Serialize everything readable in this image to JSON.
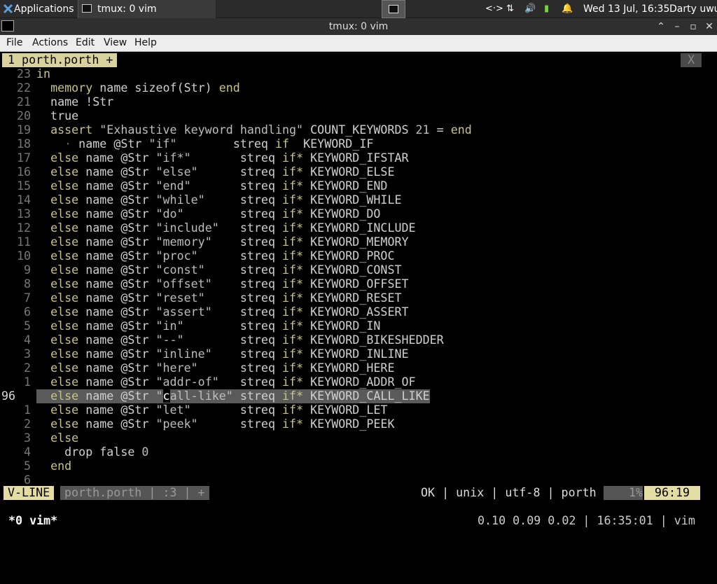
{
  "panel": {
    "applications_label": "Applications",
    "task_label": "tmux: 0 vim",
    "clock": "Wed 13 Jul, 16:35",
    "user": "Darty uwu",
    "tray_glyphs": [
      "<·>",
      "⇅",
      "🔊",
      "▮",
      "🔔"
    ]
  },
  "window": {
    "title": "tmux: 0 vim",
    "controls": [
      "⌃",
      "–",
      "▫",
      "✕"
    ]
  },
  "menubar": {
    "items": [
      "File",
      "Actions",
      "Edit",
      "View",
      "Help"
    ]
  },
  "vim": {
    "tab_label": "1 porth.porth +",
    "tab_close": "X",
    "mode": "V-LINE",
    "file_info": "porth.porth | :3 | +",
    "status_right": "OK | unix | utf-8 | porth",
    "percent": "1%",
    "position": "96:19"
  },
  "tmux": {
    "window": "*0 vim*",
    "status": "0.10 0.09 0.02 | 16:35:01 | vim"
  },
  "lines": [
    {
      "n": "23",
      "code": "in"
    },
    {
      "n": "22",
      "code": "  memory name sizeof(Str) end"
    },
    {
      "n": "21",
      "code": "  name !Str"
    },
    {
      "n": "20",
      "code": "  true"
    },
    {
      "n": "19",
      "code": "  assert \"Exhaustive keyword handling\" COUNT_KEYWORDS 21 = end"
    },
    {
      "n": "18",
      "code": "    · name @Str \"if\"        streq if  KEYWORD_IF"
    },
    {
      "n": "17",
      "code": "  else name @Str \"if*\"       streq if* KEYWORD_IFSTAR"
    },
    {
      "n": "16",
      "code": "  else name @Str \"else\"      streq if* KEYWORD_ELSE"
    },
    {
      "n": "15",
      "code": "  else name @Str \"end\"       streq if* KEYWORD_END"
    },
    {
      "n": "14",
      "code": "  else name @Str \"while\"     streq if* KEYWORD_WHILE"
    },
    {
      "n": "13",
      "code": "  else name @Str \"do\"        streq if* KEYWORD_DO"
    },
    {
      "n": "12",
      "code": "  else name @Str \"include\"   streq if* KEYWORD_INCLUDE"
    },
    {
      "n": "11",
      "code": "  else name @Str \"memory\"    streq if* KEYWORD_MEMORY"
    },
    {
      "n": "10",
      "code": "  else name @Str \"proc\"      streq if* KEYWORD_PROC"
    },
    {
      "n": "9",
      "code": "  else name @Str \"const\"     streq if* KEYWORD_CONST"
    },
    {
      "n": "8",
      "code": "  else name @Str \"offset\"    streq if* KEYWORD_OFFSET"
    },
    {
      "n": "7",
      "code": "  else name @Str \"reset\"     streq if* KEYWORD_RESET"
    },
    {
      "n": "6",
      "code": "  else name @Str \"assert\"    streq if* KEYWORD_ASSERT"
    },
    {
      "n": "5",
      "code": "  else name @Str \"in\"        streq if* KEYWORD_IN"
    },
    {
      "n": "4",
      "code": "  else name @Str \"--\"        streq if* KEYWORD_BIKESHEDDER"
    },
    {
      "n": "3",
      "code": "  else name @Str \"inline\"    streq if* KEYWORD_INLINE"
    },
    {
      "n": "2",
      "code": "  else name @Str \"here\"      streq if* KEYWORD_HERE"
    },
    {
      "n": "1",
      "code": "  else name @Str \"addr-of\"   streq if* KEYWORD_ADDR_OF"
    },
    {
      "n": "96",
      "code": "  else name @Str \"call-like\" streq if* KEYWORD_CALL_LIKE",
      "current": true
    },
    {
      "n": "1",
      "code": "  else name @Str \"let\"       streq if* KEYWORD_LET"
    },
    {
      "n": "2",
      "code": "  else name @Str \"peek\"      streq if* KEYWORD_PEEK"
    },
    {
      "n": "3",
      "code": "  else"
    },
    {
      "n": "4",
      "code": "    drop false 0"
    },
    {
      "n": "5",
      "code": "  end"
    },
    {
      "n": "6",
      "code": ""
    }
  ],
  "colors": {
    "keyword": "#c6c48a",
    "tab_active_bg": "#d9d29c",
    "selection_bg": "#5a5a5a",
    "mode_bg": "#e3dca3"
  }
}
